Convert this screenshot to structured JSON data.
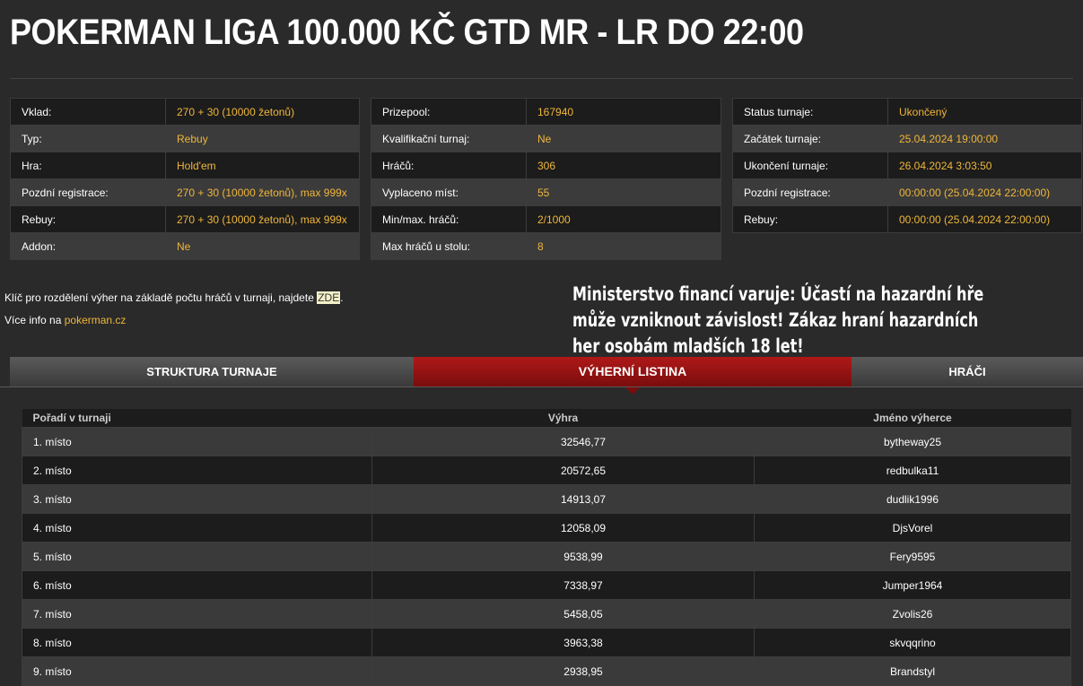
{
  "title": "POKERMAN LIGA 100.000 KČ GTD MR - LR DO 22:00",
  "info1": [
    {
      "k": "Vklad:",
      "v": "270 + 30 (10000 žetonů)"
    },
    {
      "k": "Typ:",
      "v": "Rebuy"
    },
    {
      "k": "Hra:",
      "v": "Hold'em"
    },
    {
      "k": "Pozdní registrace:",
      "v": "270 + 30 (10000 žetonů), max 999x"
    },
    {
      "k": "Rebuy:",
      "v": "270 + 30 (10000 žetonů), max 999x"
    },
    {
      "k": "Addon:",
      "v": "Ne"
    }
  ],
  "info2": [
    {
      "k": "Prizepool:",
      "v": "167940"
    },
    {
      "k": "Kvalifikační turnaj:",
      "v": "Ne"
    },
    {
      "k": "Hráčů:",
      "v": "306"
    },
    {
      "k": "Vyplaceno míst:",
      "v": "55"
    },
    {
      "k": "Min/max. hráčů:",
      "v": "2/1000"
    },
    {
      "k": "Max hráčů u stolu:",
      "v": "8"
    }
  ],
  "info3": [
    {
      "k": "Status turnaje:",
      "v": "Ukončený"
    },
    {
      "k": "Začátek turnaje:",
      "v": "25.04.2024 19:00:00"
    },
    {
      "k": "Ukončení turnaje:",
      "v": "26.04.2024 3:03:50"
    },
    {
      "k": "Pozdní registrace:",
      "v": "00:00:00 (25.04.2024 22:00:00)"
    },
    {
      "k": "Rebuy:",
      "v": "00:00:00 (25.04.2024 22:00:00)"
    }
  ],
  "note": {
    "text": "Klíč pro rozdělení výher na základě počtu hráčů v turnaji, najdete ",
    "link": "ZDE",
    "end": "."
  },
  "more": {
    "text": "Více info na ",
    "link": "pokerman.cz"
  },
  "warning": "Ministerstvo financí varuje: Účastí na hazardní hře může vzniknout závislost! Zákaz hraní hazardních her osobám mladších 18 let!",
  "tabs": [
    "STRUKTURA TURNAJE",
    "VÝHERNÍ LISTINA",
    "HRÁČI"
  ],
  "results": {
    "headers": [
      "Pořadí v turnaji",
      "Výhra",
      "Jméno výherce"
    ],
    "rows": [
      [
        "1. místo",
        "32546,77",
        "bytheway25"
      ],
      [
        "2. místo",
        "20572,65",
        "redbulka11"
      ],
      [
        "3. místo",
        "14913,07",
        "dudlik1996"
      ],
      [
        "4. místo",
        "12058,09",
        "DjsVorel"
      ],
      [
        "5. místo",
        "9538,99",
        "Fery9595"
      ],
      [
        "6. místo",
        "7338,97",
        "Jumper1964"
      ],
      [
        "7. místo",
        "5458,05",
        "Zvolis26"
      ],
      [
        "8. místo",
        "3963,38",
        "skvqqrino"
      ],
      [
        "9. místo",
        "2938,95",
        "Brandstyl"
      ]
    ]
  }
}
